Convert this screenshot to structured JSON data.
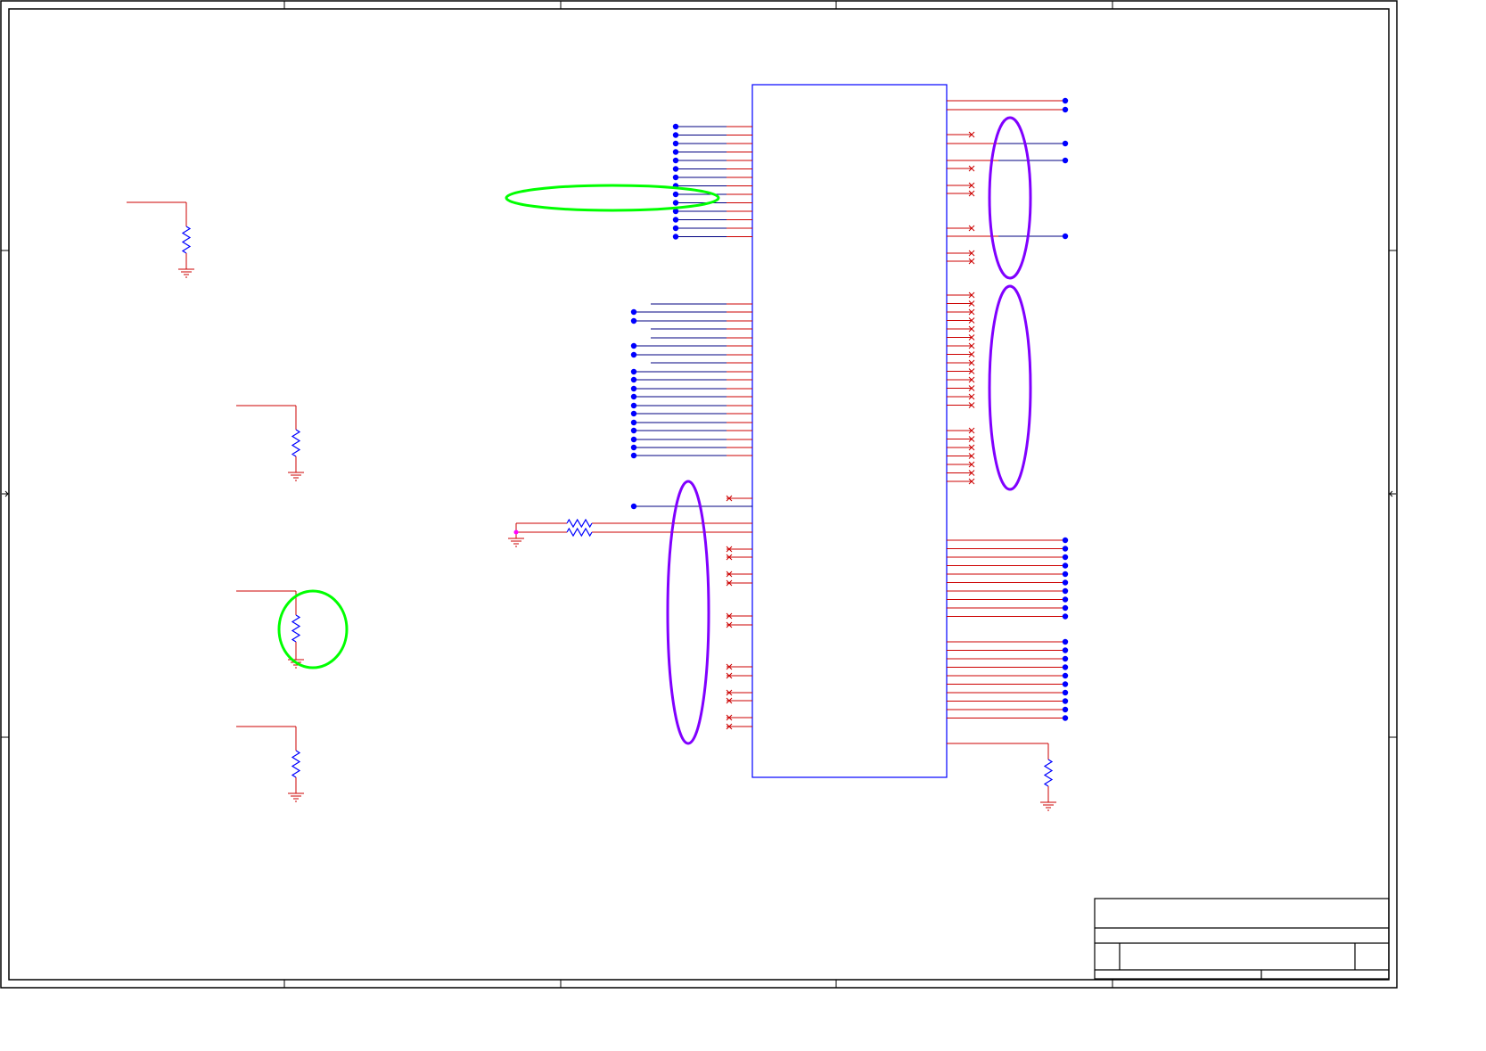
{
  "sheet": {
    "border_color": "#000000",
    "net_color": "#cc0000",
    "pin_wire_color": "#000080",
    "component_color": "#0000ff",
    "junction_color": "#0000ff",
    "highlight_green": "#00ff00",
    "highlight_purple": "#8000ff",
    "ground_symbol_color": "#cc0000",
    "pink_junction_color": "#ff00ff"
  },
  "ic": {
    "pin_count_left": 55,
    "pin_count_right": 60
  },
  "annotations": {
    "green_ellipse_count": 2,
    "purple_ellipse_count": 3
  },
  "title_block": {
    "rows": 4
  }
}
